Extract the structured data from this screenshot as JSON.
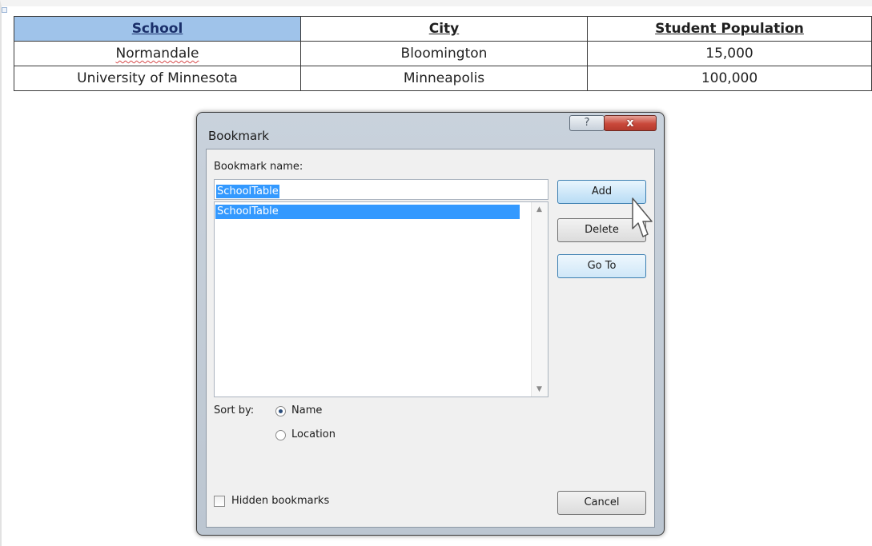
{
  "table": {
    "headers": [
      "School",
      "City",
      "Student Population"
    ],
    "rows": [
      [
        "Normandale",
        "Bloomington",
        "15,000"
      ],
      [
        "University of Minnesota",
        "Minneapolis",
        "100,000"
      ]
    ]
  },
  "dialog": {
    "title": "Bookmark",
    "help_glyph": "?",
    "close_glyph": "x",
    "name_label": "Bookmark name:",
    "name_value": "SchoolTable",
    "list_items": [
      "SchoolTable"
    ],
    "buttons": {
      "add": "Add",
      "delete": "Delete",
      "goto": "Go To",
      "cancel": "Cancel"
    },
    "sort_by_label": "Sort by:",
    "sort_options": [
      "Name",
      "Location"
    ],
    "sort_selected": "Name",
    "hidden_label": "Hidden bookmarks",
    "hidden_checked": false
  },
  "colors": {
    "selection": "#3399ff",
    "header_highlight": "#9fc3ea",
    "close_button": "#c9483a"
  }
}
